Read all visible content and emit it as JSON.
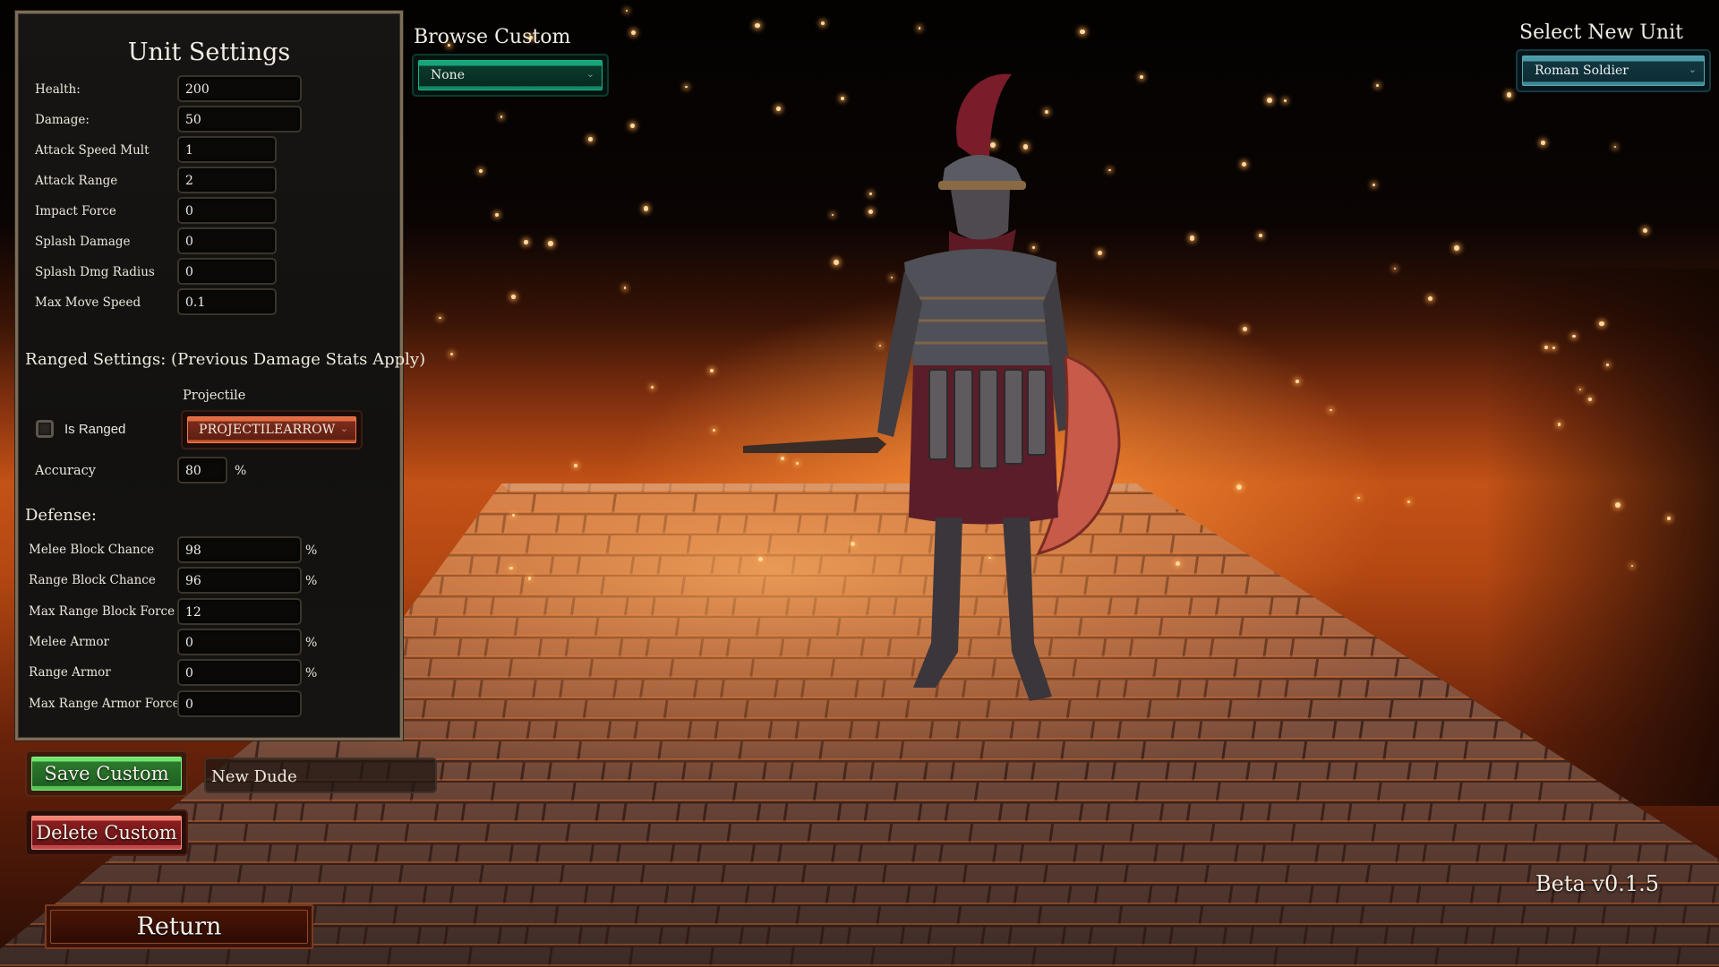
{
  "unit_settings": {
    "title": "Unit Settings",
    "fields": [
      {
        "label": "Health:",
        "value": "200"
      },
      {
        "label": "Damage:",
        "value": "50"
      },
      {
        "label": "Attack Speed Mult",
        "value": "1"
      },
      {
        "label": "Attack Range",
        "value": "2"
      },
      {
        "label": "Impact Force",
        "value": "0"
      },
      {
        "label": "Splash Damage",
        "value": "0"
      },
      {
        "label": "Splash Dmg Radius",
        "value": "0"
      },
      {
        "label": "Max Move Speed",
        "value": "0.1"
      }
    ]
  },
  "ranged": {
    "heading": "Ranged Settings:  (Previous Damage Stats Apply)",
    "projectile_label": "Projectile",
    "projectile_value": "PROJECTILEARROW",
    "is_ranged_label": "Is Ranged",
    "is_ranged_checked": false,
    "accuracy_label": "Accuracy",
    "accuracy_value": "80",
    "accuracy_unit": "%"
  },
  "defense": {
    "heading": "Defense:",
    "fields": [
      {
        "label": "Melee Block Chance",
        "value": "98",
        "unit": "%"
      },
      {
        "label": "Range Block Chance",
        "value": "96",
        "unit": "%"
      },
      {
        "label": "Max Range Block Force",
        "value": "12",
        "unit": ""
      },
      {
        "label": "Melee Armor",
        "value": "0",
        "unit": "%"
      },
      {
        "label": "Range Armor",
        "value": "0",
        "unit": "%"
      },
      {
        "label": "Max Range Armor Force",
        "value": "0",
        "unit": ""
      }
    ]
  },
  "actions": {
    "save_label": "Save Custom",
    "delete_label": "Delete Custom",
    "custom_name_value": "New Dude",
    "return_label": "Return"
  },
  "browse_custom": {
    "title": "Browse Custom",
    "selected": "None"
  },
  "select_unit": {
    "title": "Select New Unit",
    "selected": "Roman Soldier"
  },
  "version": "Beta v0.1.5",
  "colors": {
    "save_green": "#2c7a2c",
    "delete_red": "#8a1d1e",
    "projectile_orange": "#e06a42",
    "browse_teal": "#17a37a",
    "unit_blue": "#4b9aa5",
    "panel_border": "#7d6d57"
  }
}
